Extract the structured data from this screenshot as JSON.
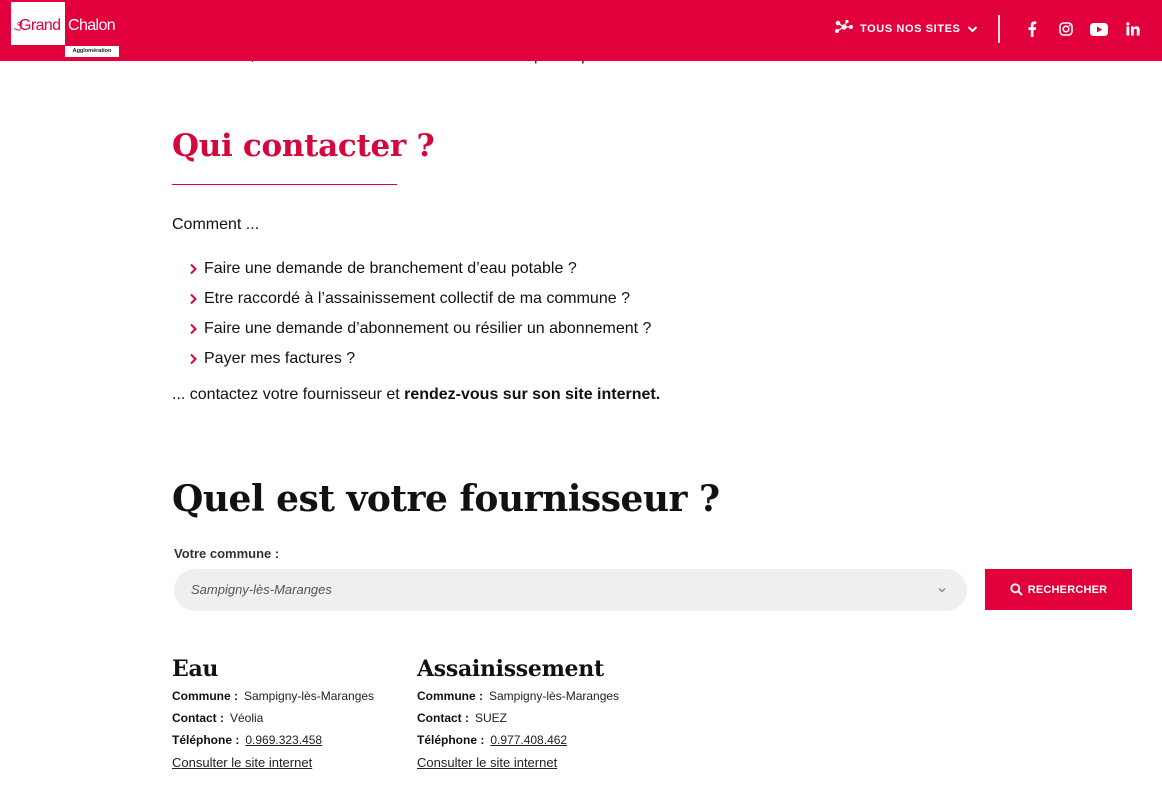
{
  "header": {
    "logo": {
      "le": "Le",
      "grand": "Grand",
      "chalon": "Chalon",
      "agglomeration": "Agglomération"
    },
    "sites_menu_label": "TOUS NOS SITES",
    "social": [
      "facebook-icon",
      "instagram-icon",
      "youtube-icon",
      "linkedin-icon"
    ],
    "accent_color": "#e1003c"
  },
  "content": {
    "clipped_line": "communes, ces missions sont confiées à des entreprises privées.",
    "contact_heading": "Qui contacter ?",
    "intro": "Comment ...",
    "items": [
      "Faire une demande de branchement d’eau potable ?",
      "Etre raccordé à l’assainissement collectif de ma commune ?",
      "Faire une demande d’abonnement ou résilier un abonnement ?",
      "Payer mes factures ?"
    ],
    "outro_prefix": "... contactez votre fournisseur et ",
    "outro_bold": "rendez-vous sur son site internet",
    "outro_suffix": "."
  },
  "finder": {
    "heading": "Quel est votre fournisseur ?",
    "commune_label": "Votre commune :",
    "commune_value": "Sampigny-lès-Maranges",
    "search_label": "RECHERCHER"
  },
  "providers": [
    {
      "title": "Eau",
      "commune_key": "Commune :",
      "commune": "Sampigny-lès-Maranges",
      "contact_key": "Contact :",
      "contact": "Véolia",
      "phone_key": "Téléphone :",
      "phone": "0.969.323.458",
      "link": "Consulter le site internet"
    },
    {
      "title": "Assainissement",
      "commune_key": "Commune :",
      "commune": "Sampigny-lès-Maranges",
      "contact_key": "Contact :",
      "contact": "SUEZ",
      "phone_key": "Téléphone :",
      "phone": "0.977.408.462",
      "link": "Consulter le site internet"
    }
  ]
}
